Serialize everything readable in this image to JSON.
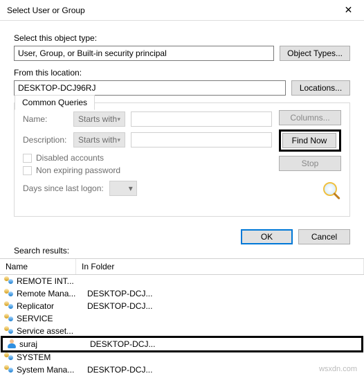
{
  "titlebar": {
    "title": "Select User or Group"
  },
  "objtype": {
    "label": "Select this object type:",
    "value": "User, Group, or Built-in security principal",
    "button": "Object Types..."
  },
  "location": {
    "label": "From this location:",
    "value": "DESKTOP-DCJ96RJ",
    "button": "Locations..."
  },
  "queries": {
    "tab": "Common Queries",
    "name_label": "Name:",
    "desc_label": "Description:",
    "starts_with": "Starts with",
    "cb_disabled": "Disabled accounts",
    "cb_nonexpire": "Non expiring password",
    "logon_label": "Days since last logon:",
    "btn_columns": "Columns...",
    "btn_findnow": "Find Now",
    "btn_stop": "Stop"
  },
  "actions": {
    "ok": "OK",
    "cancel": "Cancel"
  },
  "results": {
    "label": "Search results:",
    "col_name": "Name",
    "col_folder": "In Folder",
    "rows": [
      {
        "icon": "group",
        "name": "REMOTE INT...",
        "folder": ""
      },
      {
        "icon": "group",
        "name": "Remote Mana...",
        "folder": "DESKTOP-DCJ..."
      },
      {
        "icon": "group",
        "name": "Replicator",
        "folder": "DESKTOP-DCJ..."
      },
      {
        "icon": "group",
        "name": "SERVICE",
        "folder": ""
      },
      {
        "icon": "group",
        "name": "Service asset...",
        "folder": ""
      },
      {
        "icon": "user",
        "name": "suraj",
        "folder": "DESKTOP-DCJ...",
        "selected": true
      },
      {
        "icon": "group",
        "name": "SYSTEM",
        "folder": ""
      },
      {
        "icon": "group",
        "name": "System Mana...",
        "folder": "DESKTOP-DCJ..."
      }
    ]
  },
  "watermark": "wsxdn.com"
}
